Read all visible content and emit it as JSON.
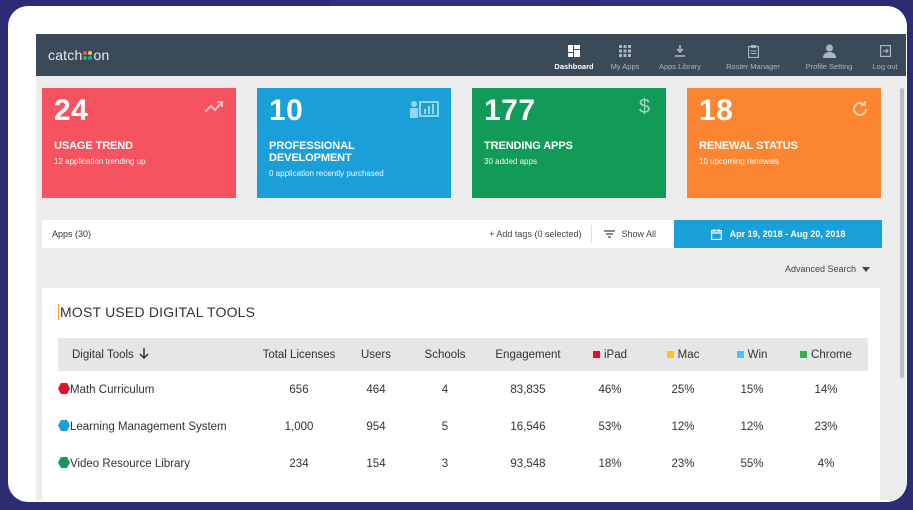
{
  "app": {
    "logo_left": "catch",
    "logo_right": "on",
    "nav": [
      {
        "label": "Dashboard",
        "icon": "dashboard-icon"
      },
      {
        "label": "My Apps",
        "icon": "grid-icon"
      },
      {
        "label": "Apps Library",
        "icon": "download-icon"
      },
      {
        "label": "Roster Manager",
        "icon": "clipboard-icon"
      },
      {
        "label": "Profile Setting",
        "icon": "user-icon"
      },
      {
        "label": "Log out",
        "icon": "logout-icon"
      }
    ]
  },
  "cards": [
    {
      "number": "24",
      "title": "USAGE TREND",
      "subtitle": "12 application trending up",
      "color": "#f5535f",
      "icon": "trending-up-icon"
    },
    {
      "number": "10",
      "title": "PROFESSIONAL DEVELOPMENT",
      "subtitle": "0 application recently purchased",
      "color": "#1a9fd9",
      "icon": "presentation-icon"
    },
    {
      "number": "177",
      "title": "TRENDING APPS",
      "subtitle": "30 added apps",
      "color": "#129a59",
      "icon": "dollar-icon"
    },
    {
      "number": "18",
      "title": "RENEWAL STATUS",
      "subtitle": "10 upcoming renewals",
      "color": "#fb8530",
      "icon": "refresh-icon"
    }
  ],
  "filters": {
    "apps_count": "Apps (30)",
    "add_tags": "+ Add tags (0 selected)",
    "show_all": "Show All",
    "date_range": "Apr 19, 2018 - Aug 20, 2018",
    "advanced_search": "Advanced Search"
  },
  "table": {
    "title": "MOST USED DIGITAL TOOLS",
    "headers": [
      "Digital Tools",
      "Total Licenses",
      "Users",
      "Schools",
      "Engagement",
      "iPad",
      "Mac",
      "Win",
      "Chrome"
    ],
    "platform_colors": {
      "iPad": "#e0102e",
      "Mac": "#f9c623",
      "Win": "#4cc3ee",
      "Chrome": "#2fb14f"
    },
    "rows": [
      {
        "name": "Math Curriculum",
        "color": "#e0102e",
        "licenses": "656",
        "users": "464",
        "schools": "4",
        "engagement": "83,835",
        "ipad": "46%",
        "mac": "25%",
        "win": "15%",
        "chrome": "14%"
      },
      {
        "name": "Learning Management System",
        "color": "#1a9fd9",
        "licenses": "1,000",
        "users": "954",
        "schools": "5",
        "engagement": "16,546",
        "ipad": "53%",
        "mac": "12%",
        "win": "12%",
        "chrome": "23%"
      },
      {
        "name": "Video Resource Library",
        "color": "#129a59",
        "licenses": "234",
        "users": "154",
        "schools": "3",
        "engagement": "93,548",
        "ipad": "18%",
        "mac": "23%",
        "win": "55%",
        "chrome": "4%"
      }
    ]
  }
}
